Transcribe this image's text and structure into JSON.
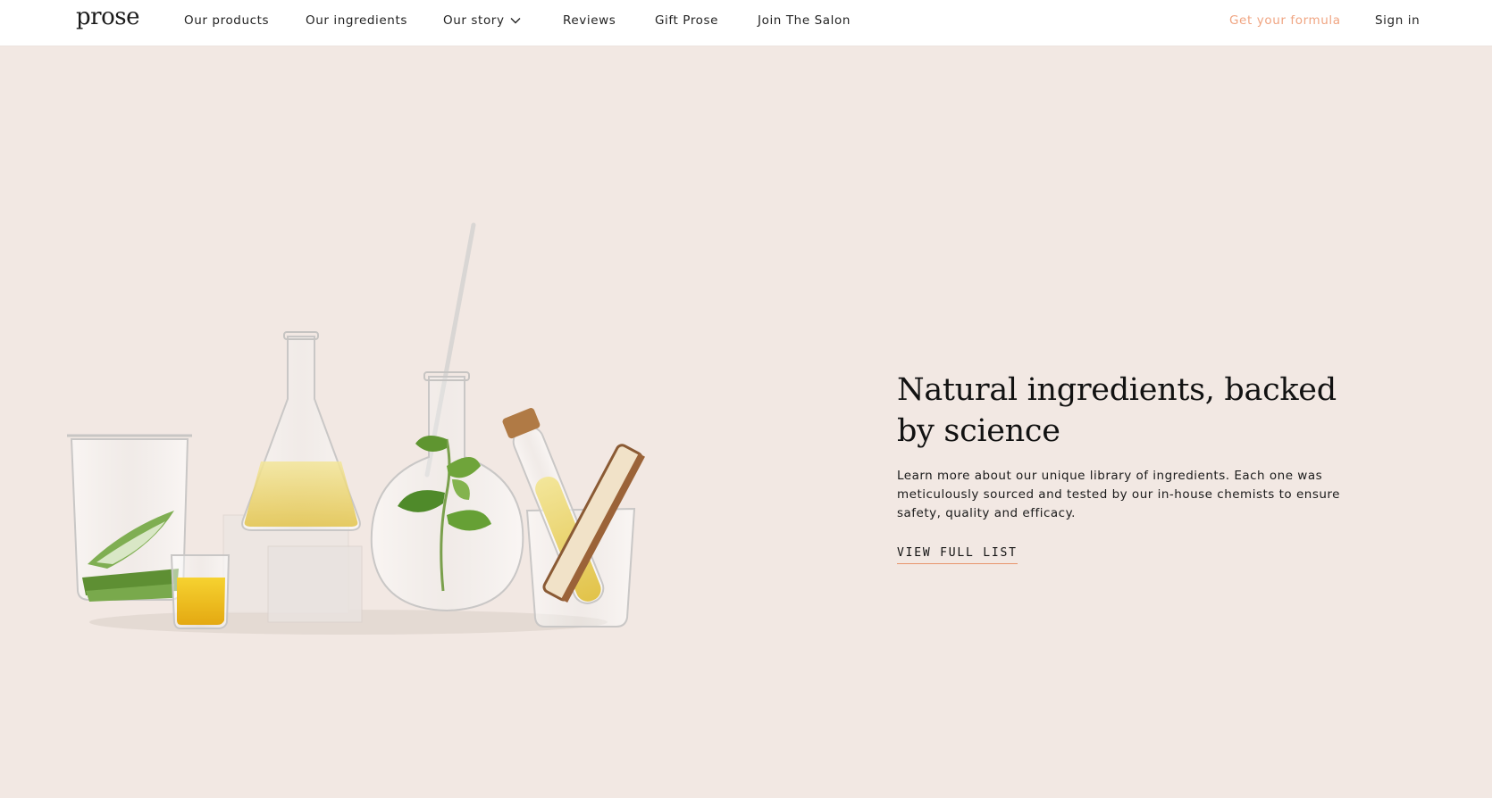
{
  "header": {
    "logo": "prose",
    "nav": [
      {
        "label": "Our products"
      },
      {
        "label": "Our ingredients"
      },
      {
        "label": "Our story",
        "has_dropdown": true
      },
      {
        "label": "Reviews"
      },
      {
        "label": "Gift Prose"
      },
      {
        "label": "Join The Salon"
      }
    ],
    "cta_label": "Get your formula",
    "signin_label": "Sign in"
  },
  "hero": {
    "headline": "Natural ingredients, backed by science",
    "description": "Learn more about our unique library of ingredients. Each one was meticulously sourced and tested by our in-house chemists to ensure safety, quality and efficacy.",
    "link_label": "VIEW FULL LIST"
  },
  "colors": {
    "background": "#f2e8e3",
    "accent": "#f0a582",
    "link_underline": "#e8946c",
    "nav_bg": "#ffffff"
  },
  "icons": {
    "dropdown": "chevron-down-icon"
  }
}
